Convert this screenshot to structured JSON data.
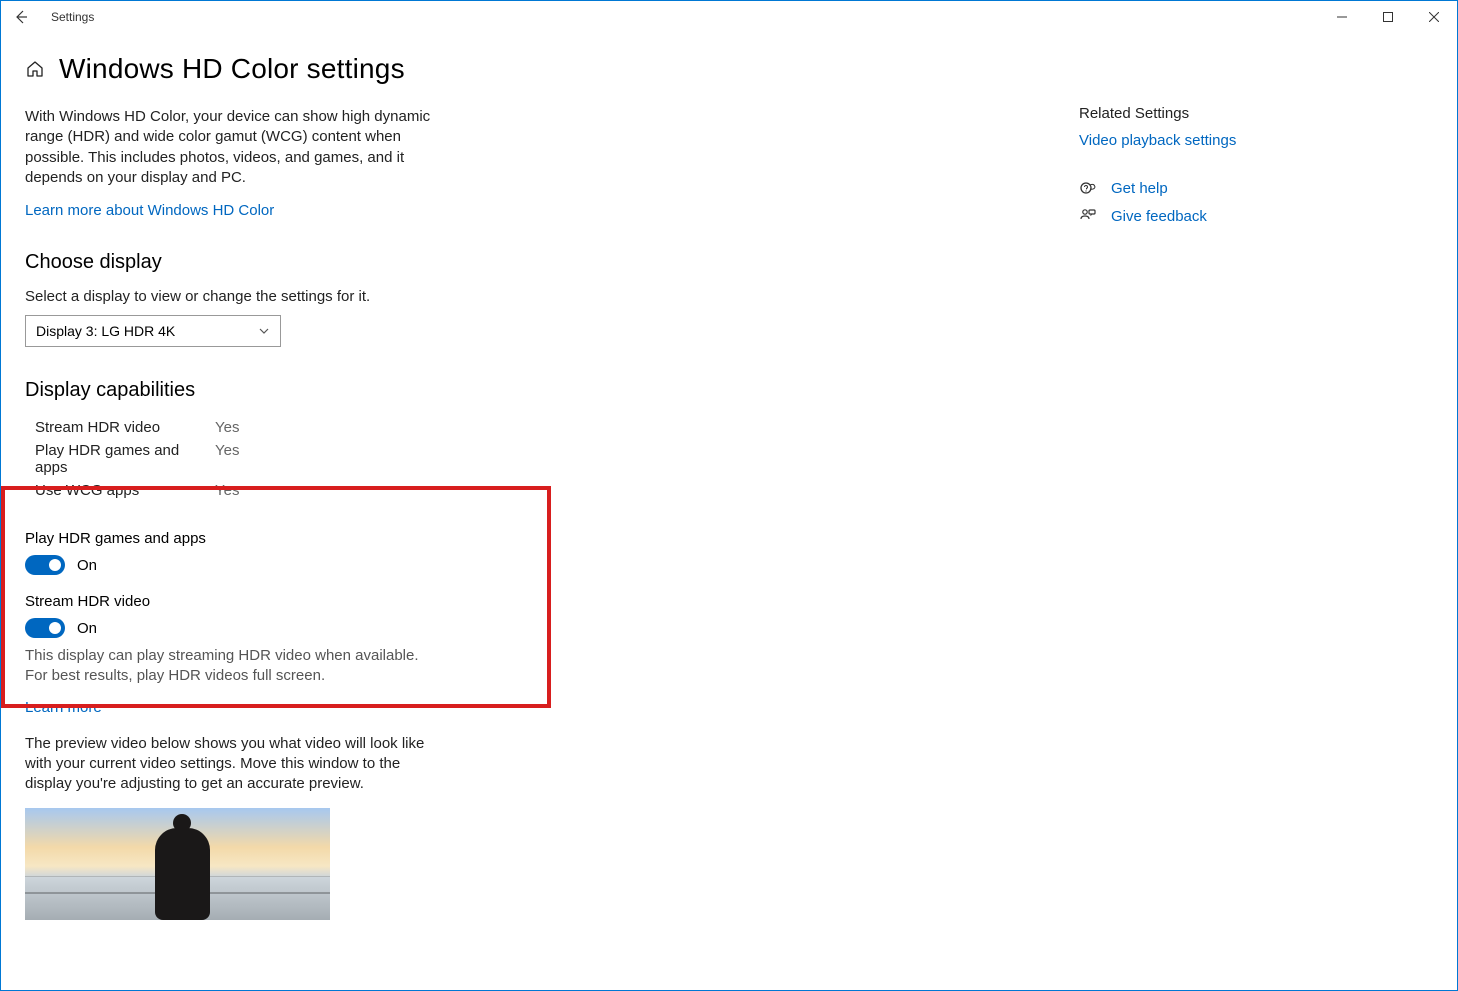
{
  "window": {
    "title": "Settings"
  },
  "header": {
    "page_title": "Windows HD Color settings"
  },
  "intro": {
    "text": "With Windows HD Color, your device can show high dynamic range (HDR) and wide color gamut (WCG) content when possible. This includes photos, videos, and games, and it depends on your display and PC.",
    "learn_more": "Learn more about Windows HD Color"
  },
  "choose_display": {
    "heading": "Choose display",
    "sub": "Select a display to view or change the settings for it.",
    "selected": "Display 3: LG HDR 4K"
  },
  "capabilities": {
    "heading": "Display capabilities",
    "rows": [
      {
        "label": "Stream HDR video",
        "value": "Yes"
      },
      {
        "label": "Play HDR games and apps",
        "value": "Yes"
      },
      {
        "label": "Use WCG apps",
        "value": "Yes"
      }
    ]
  },
  "toggles": {
    "play_hdr": {
      "label": "Play HDR games and apps",
      "state": "On"
    },
    "stream_hdr": {
      "label": "Stream HDR video",
      "state": "On",
      "helper": "This display can play streaming HDR video when available. For best results, play HDR videos full screen.",
      "learn_more": "Learn more"
    }
  },
  "preview": {
    "text": "The preview video below shows you what video will look like with your current video settings. Move this window to the display you're adjusting to get an accurate preview."
  },
  "sidebar": {
    "heading": "Related Settings",
    "video_link": "Video playback settings",
    "help": "Get help",
    "feedback": "Give feedback"
  }
}
